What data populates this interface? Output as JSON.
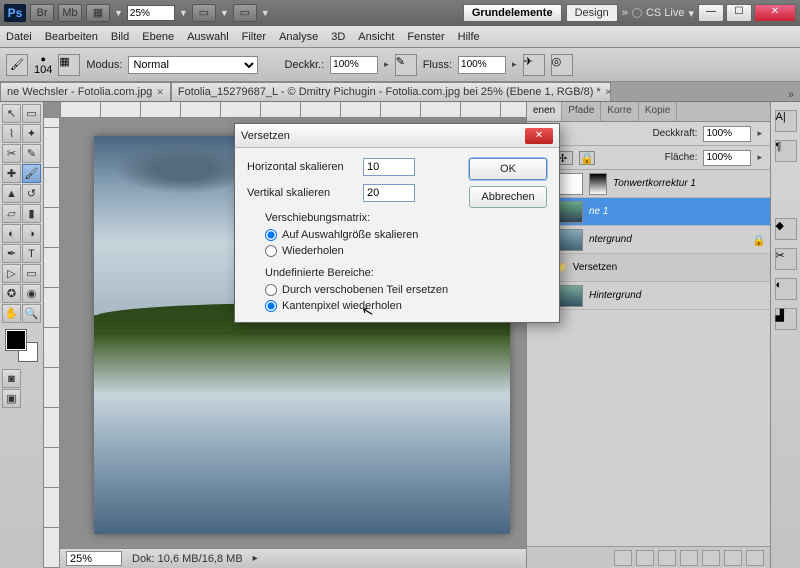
{
  "titlebar": {
    "ps": "Ps",
    "br": "Br",
    "mb": "Mb",
    "zoom": "25%",
    "workspaces": {
      "a": "Grundelemente",
      "b": "Design"
    },
    "more": "»",
    "cslive": "CS Live"
  },
  "menubar": [
    "Datei",
    "Bearbeiten",
    "Bild",
    "Ebene",
    "Auswahl",
    "Filter",
    "Analyse",
    "3D",
    "Ansicht",
    "Fenster",
    "Hilfe"
  ],
  "optbar": {
    "brush_size": "104",
    "mode_lbl": "Modus:",
    "mode_val": "Normal",
    "opacity_lbl": "Deckkr.:",
    "opacity_val": "100%",
    "flow_lbl": "Fluss:",
    "flow_val": "100%"
  },
  "doctabs": {
    "t1": "ne Wechsler - Fotolia.com.jpg",
    "t2": "Fotolia_15279687_L - © Dmitry Pichugin - Fotolia.com.jpg bei 25% (Ebene 1, RGB/8) *"
  },
  "status": {
    "zoom": "25%",
    "doc": "Dok: 10,6 MB/16,8 MB"
  },
  "panel": {
    "tabs": [
      "enen",
      "Pfade",
      "Korre",
      "Kopie"
    ],
    "opacity_lbl": "Deckkraft:",
    "opacity_val": "100%",
    "fill_lbl": "Fläche:",
    "fill_val": "100%",
    "layers": {
      "l1": "Tonwertkorrektur 1",
      "l2": "ne 1",
      "l3": "ntergrund",
      "l4": "Versetzen",
      "l5": "Hintergrund"
    }
  },
  "dialog": {
    "title": "Versetzen",
    "h_lbl": "Horizontal skalieren",
    "h_val": "10",
    "v_lbl": "Vertikal skalieren",
    "v_val": "20",
    "g1": "Verschiebungsmatrix:",
    "g1a": "Auf Auswahlgröße skalieren",
    "g1b": "Wiederholen",
    "g2": "Undefinierte Bereiche:",
    "g2a": "Durch verschobenen Teil ersetzen",
    "g2b": "Kantenpixel wiederholen",
    "ok": "OK",
    "cancel": "Abbrechen"
  }
}
